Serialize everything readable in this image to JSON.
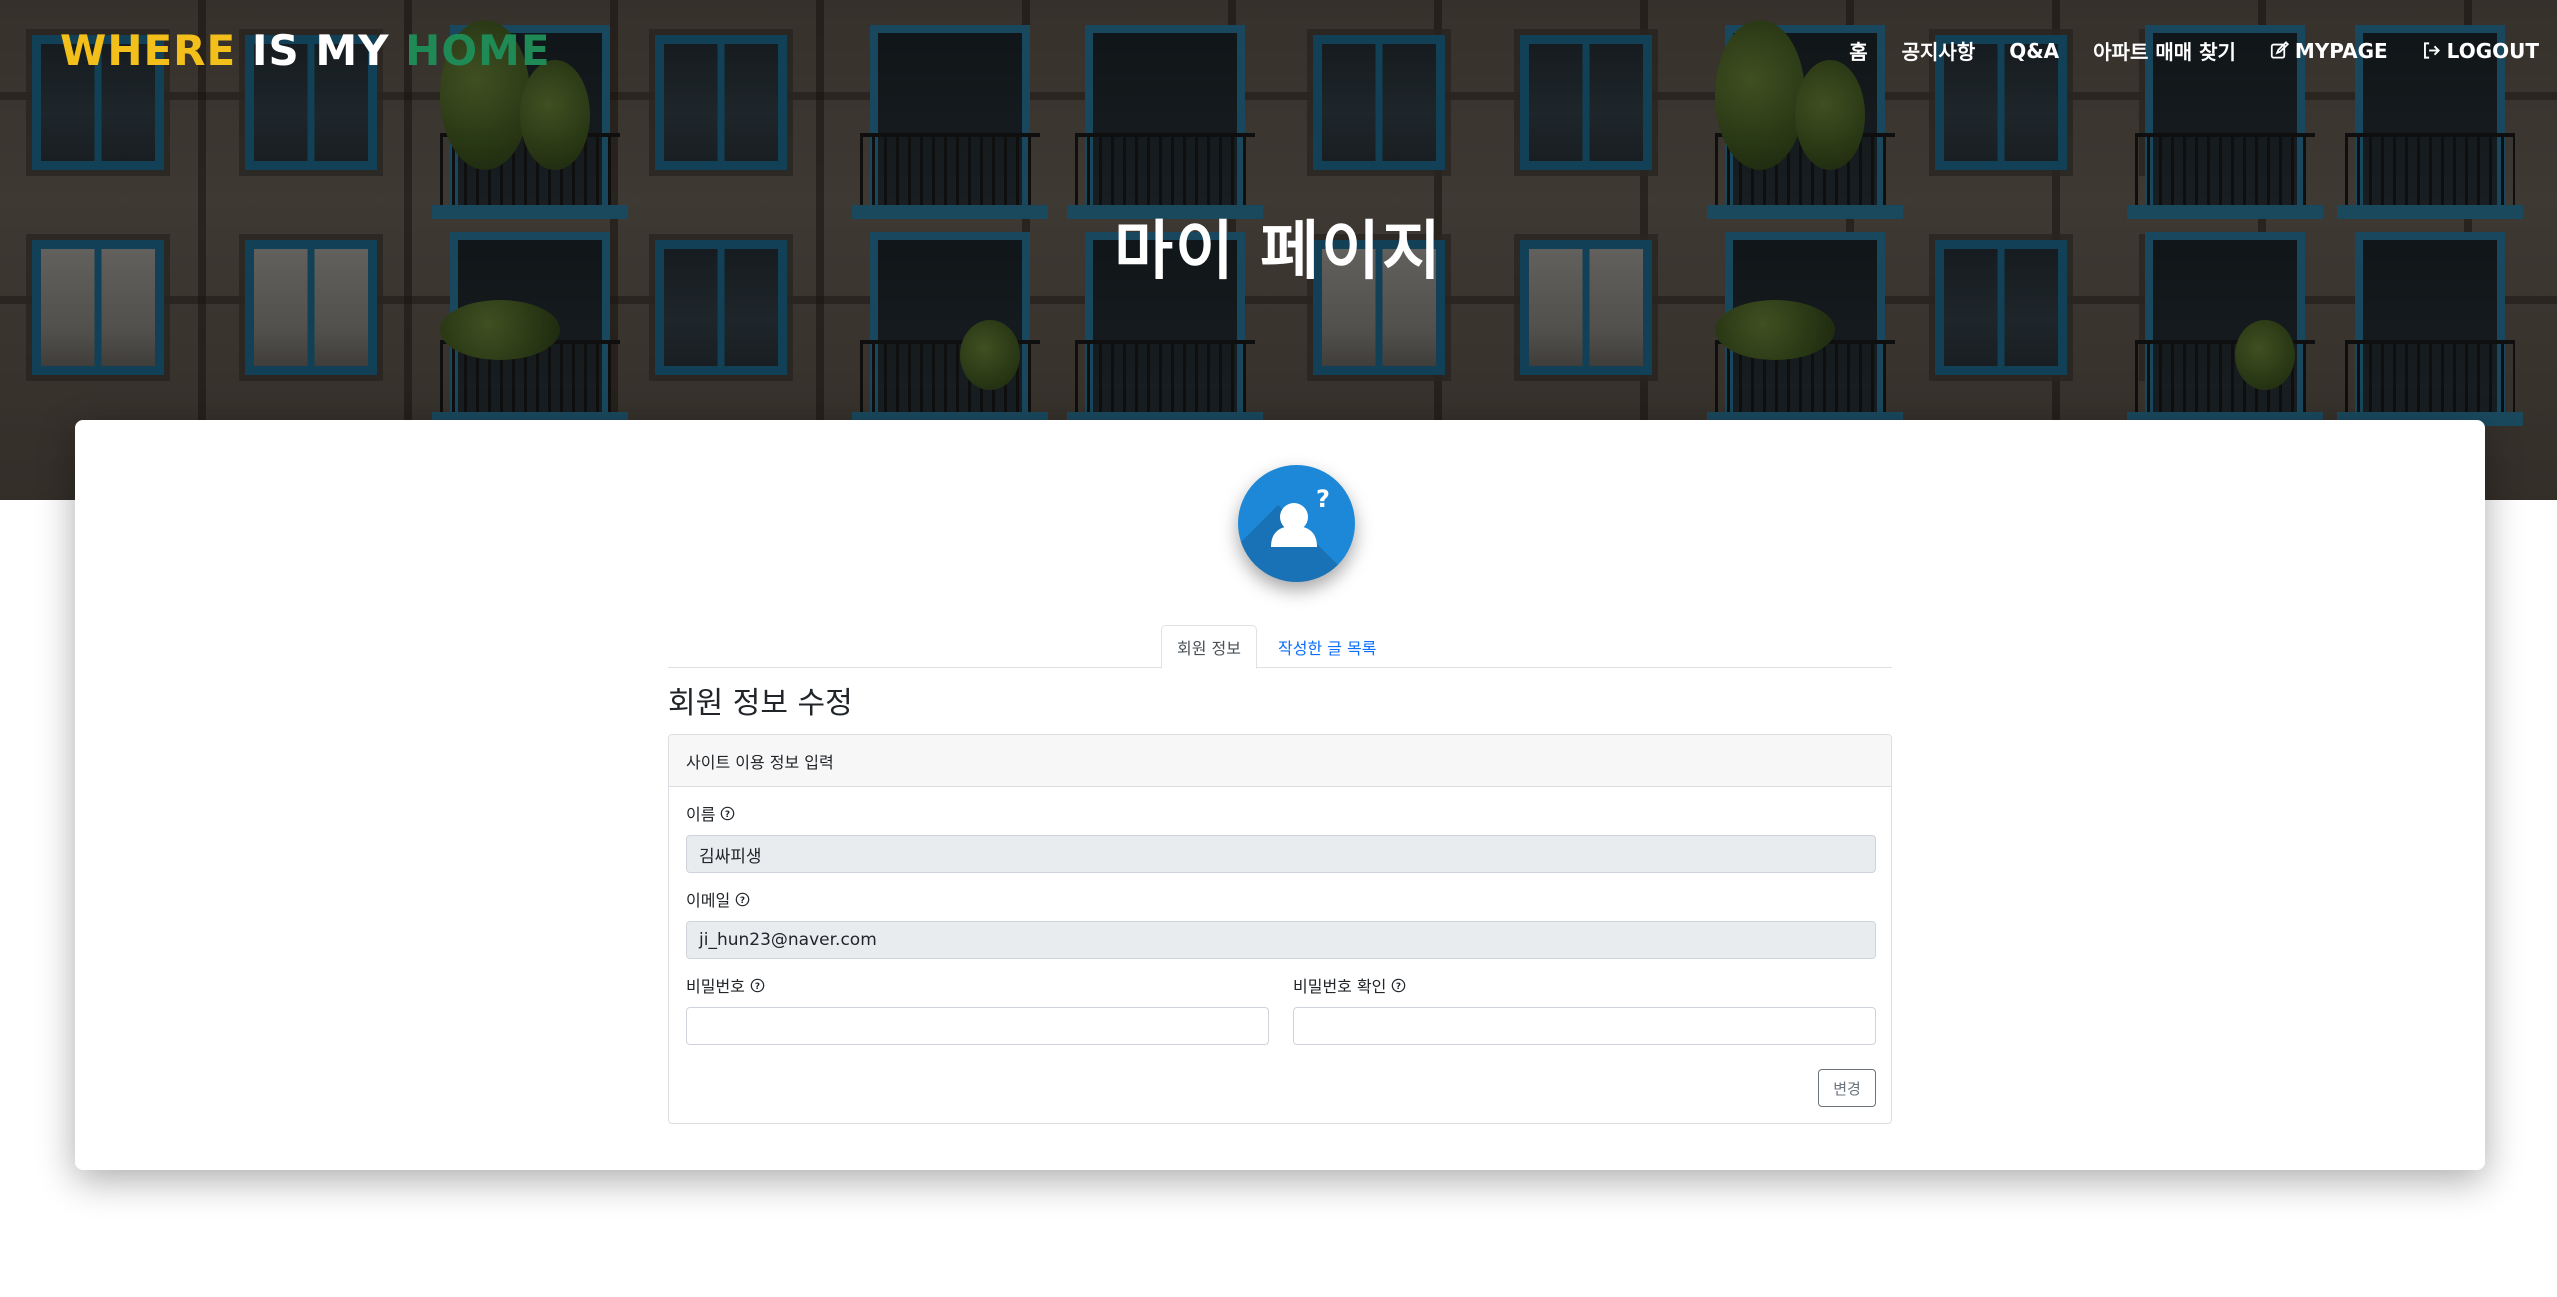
{
  "navbar": {
    "brand": {
      "part1": "WHERE",
      "part2": "IS MY",
      "part3": "HOME"
    },
    "items": [
      {
        "label": "홈",
        "icon": ""
      },
      {
        "label": "공지사항",
        "icon": ""
      },
      {
        "label": "Q&A",
        "icon": ""
      },
      {
        "label": "아파트 매매 찾기",
        "icon": ""
      },
      {
        "label": "MYPAGE",
        "icon": "edit-icon"
      },
      {
        "label": "LOGOUT",
        "icon": "logout-icon"
      }
    ]
  },
  "hero": {
    "title": "마이 페이지"
  },
  "profile": {
    "avatar_icon": "unknown-user-icon"
  },
  "tabs": [
    {
      "label": "회원 정보",
      "active": true
    },
    {
      "label": "작성한 글 목록",
      "active": false
    }
  ],
  "form": {
    "title": "회원 정보 수정",
    "panel_header": "사이트 이용 정보 입력",
    "name": {
      "label": "이름",
      "value": "김싸피생"
    },
    "email": {
      "label": "이메일",
      "value": "ji_hun23@naver.com"
    },
    "password": {
      "label": "비밀번호",
      "value": ""
    },
    "password_confirm": {
      "label": "비밀번호 확인",
      "value": ""
    },
    "submit_label": "변경"
  },
  "colors": {
    "brand_yellow": "#f3bf1a",
    "brand_green": "#1f8a55",
    "avatar_blue": "#1e88d8",
    "link_blue": "#0d6efd"
  }
}
